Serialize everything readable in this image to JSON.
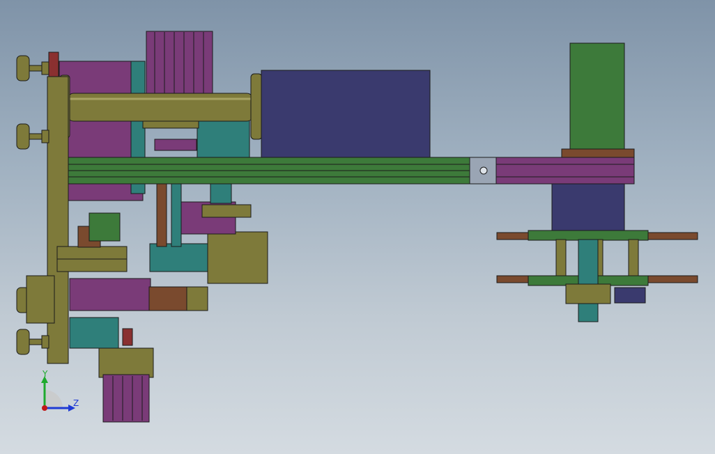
{
  "viewport": {
    "background_top": "#7f93a8",
    "background_bottom": "#d4dbe1"
  },
  "palette": {
    "purple": "#7a3b78",
    "olive": "#7e7a3a",
    "green": "#3d7a3a",
    "navy": "#3a3a6e",
    "teal": "#2f7f7a",
    "brown": "#7a4a2e",
    "red": "#8a3030",
    "edge": "#1b1b1b"
  },
  "triad": {
    "y_label": "Y",
    "z_label": "Z",
    "y_color": "#1faa2e",
    "z_color": "#1f3ad4",
    "origin_color": "#c01818"
  }
}
